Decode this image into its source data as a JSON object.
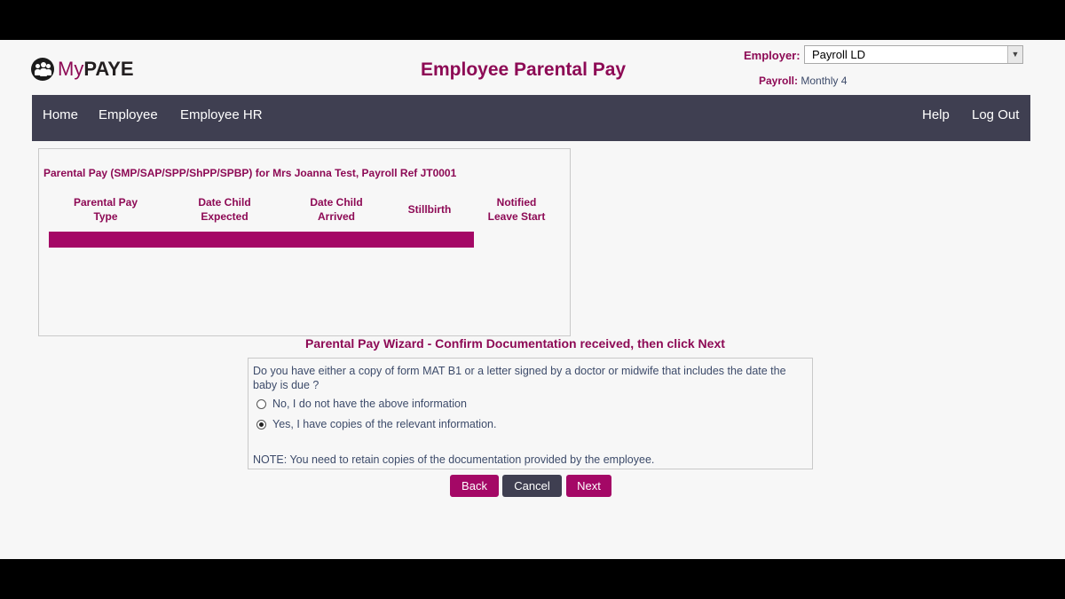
{
  "logo": {
    "prefix": "My",
    "name": "PAYE"
  },
  "header": {
    "title": "Employee Parental Pay",
    "employer_label": "Employer:",
    "employer_value": "Payroll LD",
    "payroll_label": "Payroll:",
    "payroll_value": "Monthly 4"
  },
  "nav": {
    "left": [
      "Home",
      "Employee",
      "Employee HR"
    ],
    "right": [
      "Help",
      "Log Out"
    ]
  },
  "parental_pay": {
    "title": "Parental Pay (SMP/SAP/SPP/ShPP/SPBP) for Mrs Joanna Test, Payroll Ref JT0001",
    "columns": [
      {
        "line1": "Parental Pay",
        "line2": "Type"
      },
      {
        "line1": "Date Child",
        "line2": "Expected"
      },
      {
        "line1": "Date Child",
        "line2": "Arrived"
      },
      {
        "line1": "Stillbirth",
        "line2": ""
      },
      {
        "line1": "Notified",
        "line2": "Leave Start"
      }
    ]
  },
  "wizard": {
    "title": "Parental Pay Wizard - Confirm Documentation received, then click Next",
    "question": "Do you have either a copy of form MAT B1 or a letter signed by a doctor or midwife that includes the date the baby is due ?",
    "options": [
      {
        "label": "No, I do not have the above information",
        "checked": false
      },
      {
        "label": "Yes, I have copies of the relevant information.",
        "checked": true
      }
    ],
    "note": "NOTE: You need to retain copies of the documentation provided by the employee."
  },
  "buttons": {
    "back": "Back",
    "cancel": "Cancel",
    "next": "Next"
  },
  "colors": {
    "brand": "#8d0a55",
    "accent": "#a40866",
    "nav": "#3f3f51",
    "text": "#3d4b6a"
  }
}
